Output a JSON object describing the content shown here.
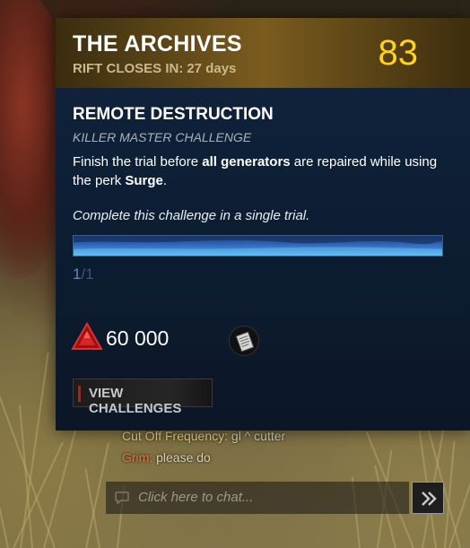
{
  "archive": {
    "title": "THE ARCHIVES",
    "rift_label": "RIFT CLOSES IN:",
    "rift_value": "27 days",
    "tier": "83"
  },
  "challenge": {
    "title": "REMOTE DESTRUCTION",
    "subtitle": "KILLER MASTER CHALLENGE",
    "desc_part1": "Finish the trial before ",
    "desc_bold1": "all generators",
    "desc_part2": " are repaired while using the perk ",
    "desc_bold2": "Surge",
    "desc_part3": ".",
    "note": "Complete this challenge in a single trial.",
    "progress_current": "1",
    "progress_separator": "/",
    "progress_total": "1",
    "progress_fraction": 1.0
  },
  "rewards": {
    "shards": "60 000",
    "shard_icon": "rift-fragment-icon",
    "scroll_icon": "scroll-icon"
  },
  "buttons": {
    "view_challenges": "VIEW CHALLENGES"
  },
  "chat": {
    "messages": [
      {
        "author": "Cut Off Frequency:",
        "text": "gl ^ cutter"
      },
      {
        "author": "Grim:",
        "text": "please do"
      }
    ],
    "placeholder": "Click here to chat..."
  },
  "colors": {
    "tier": "#ffd21f",
    "progress": "#3c86d6",
    "accent_red": "#c01818"
  }
}
